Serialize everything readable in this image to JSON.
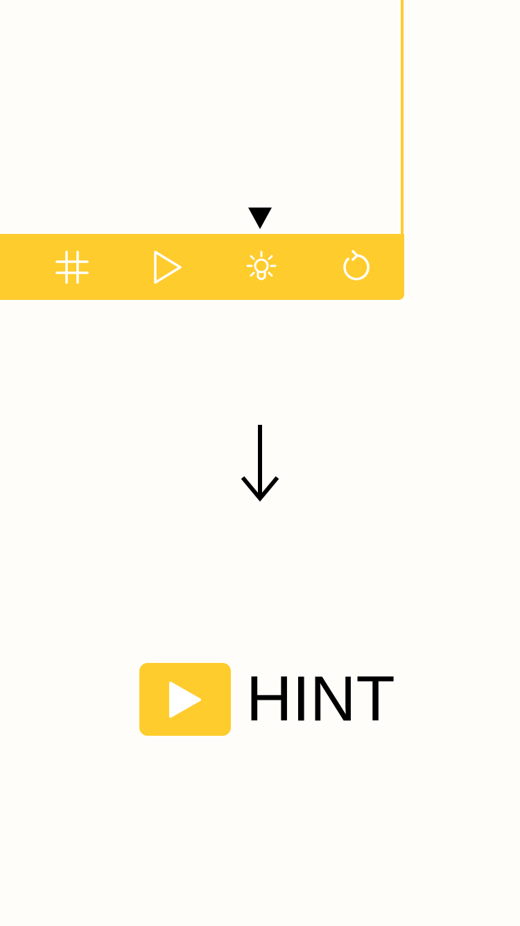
{
  "colors": {
    "accent": "#ffcc2d",
    "background": "#fffdfa",
    "icon": "#ffffff",
    "text": "#000000"
  },
  "toolbar": {
    "buttons": [
      {
        "name": "grid-icon",
        "label": ""
      },
      {
        "name": "play-icon",
        "label": ""
      },
      {
        "name": "lightbulb-icon",
        "label": ""
      },
      {
        "name": "restart-icon",
        "label": ""
      }
    ]
  },
  "hint": {
    "icon": "play-icon",
    "label": "HINT"
  }
}
